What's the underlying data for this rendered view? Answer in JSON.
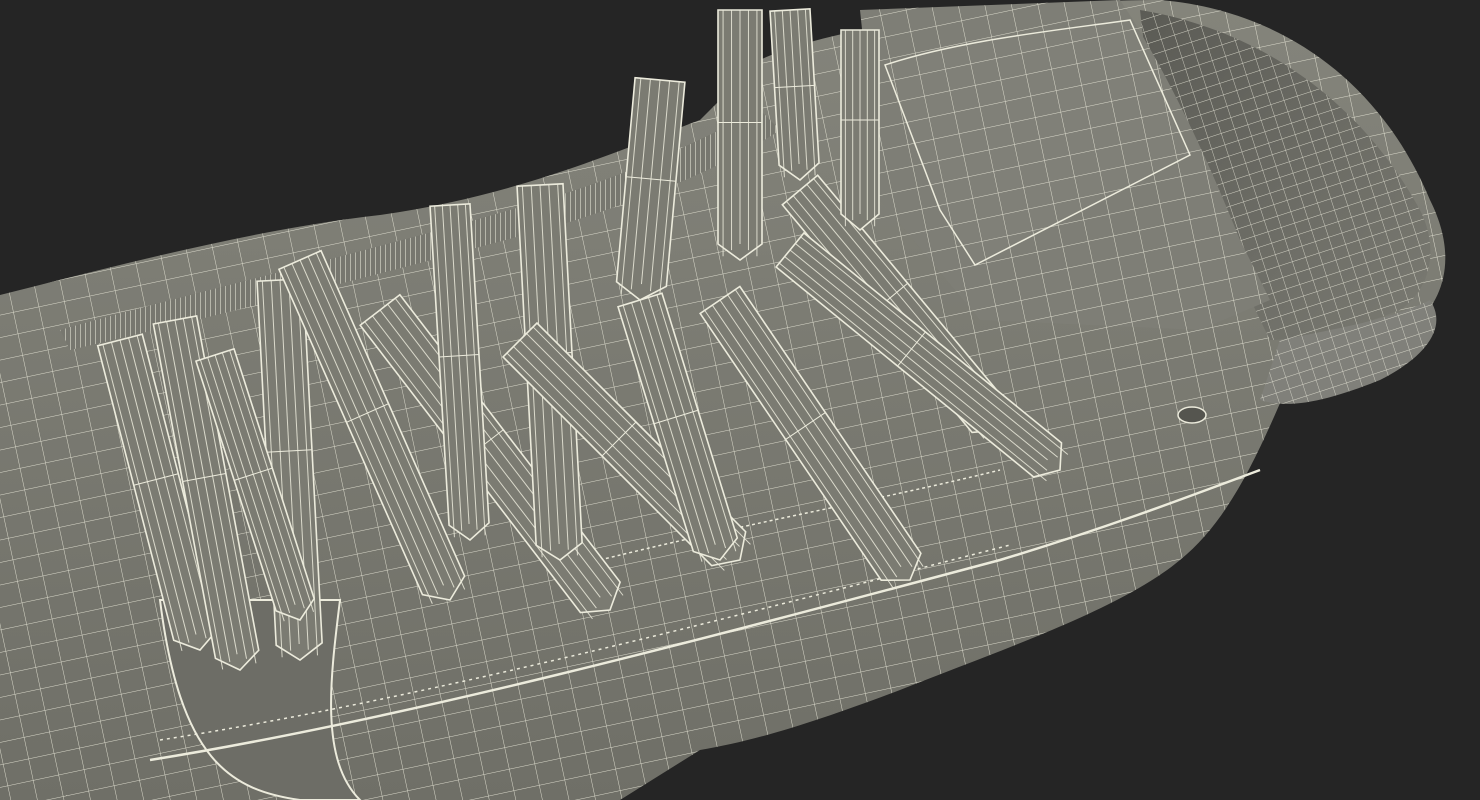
{
  "render": {
    "background_color": "#252525",
    "surface_color": "#7b7b72",
    "surface_shadow_color": "#5c5c55",
    "surface_light_color": "#8d8d84",
    "wire_color": "#ecebdc"
  },
  "model": {
    "subject": "boot-wireframe-render"
  }
}
